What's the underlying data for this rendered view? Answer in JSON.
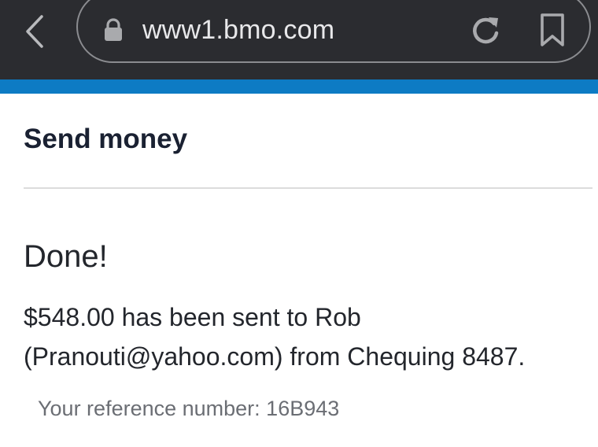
{
  "browser": {
    "url": "www1.bmo.com",
    "back_icon": "chevron-left-icon",
    "lock_icon": "lock-icon",
    "reload_icon": "reload-icon",
    "bookmark_icon": "bookmark-icon",
    "bar_color": "#2b2c30",
    "accent_color": "#0d7bc4"
  },
  "page": {
    "title": "Send money",
    "status": "Done!",
    "message_line1": "$548.00 has been sent to Rob",
    "message_line2": "(Pranouti@yahoo.com) from Chequing 8487.",
    "reference_label": "Your reference number: ",
    "reference_number": "16B943"
  }
}
